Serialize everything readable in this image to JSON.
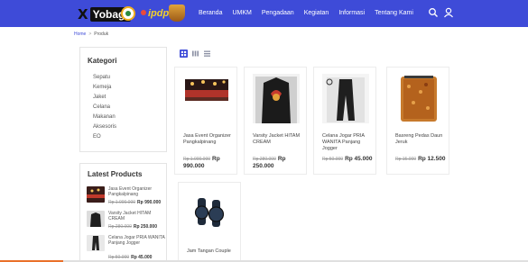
{
  "header": {
    "logo_text": "Yobagi",
    "logo_mark": "X",
    "partner_logo_text": "ipdp",
    "nav": [
      "Beranda",
      "UMKM",
      "Pengadaan",
      "Kegiatan",
      "Informasi",
      "Tentang Kami"
    ],
    "icons": [
      "search-icon",
      "user-icon"
    ],
    "accent": "#3e4bd8"
  },
  "breadcrumb": {
    "home": "Home",
    "separator": ">",
    "current": "Produk"
  },
  "sidebar": {
    "categories_title": "Kategori",
    "categories": [
      "Sepatu",
      "Kemeja",
      "Jaket",
      "Celana",
      "Makanan",
      "Aksesoris",
      "EO"
    ],
    "latest_title": "Latest Products",
    "latest": [
      {
        "name": "Jasa Event Organizer Pangkalpinang",
        "old_price": "Rp 1.000.000",
        "price": "Rp 990.000"
      },
      {
        "name": "Varsity Jacket HITAM CREAM",
        "old_price": "Rp 280.000",
        "price": "Rp 250.000"
      },
      {
        "name": "Celana Jogar PRIA WANITA Panjang Jogger",
        "old_price": "Rp 50.000",
        "price": "Rp 45.000"
      }
    ]
  },
  "view_toggles": [
    "grid-large-icon",
    "grid-small-icon",
    "list-icon"
  ],
  "products": [
    {
      "name": "Jasa Event Organizer Pangkalpinang",
      "old_price": "Rp 1.000.000",
      "price_prefix": "Rp",
      "price": "990.000"
    },
    {
      "name": "Varsity Jacket HITAM CREAM",
      "old_price": "Rp 280.000",
      "price_prefix": "Rp",
      "price": "250.000"
    },
    {
      "name": "Celana Jogar PRIA WANITA Panjang Jogger",
      "old_price": "Rp 50.000",
      "price_prefix": "",
      "price": "Rp 45.000"
    },
    {
      "name": "Basreng Pedas Daun Jeruk",
      "old_price": "Rp 15.000",
      "price_prefix": "",
      "price": "Rp 12.500"
    },
    {
      "name": "Jam Tangan Couple",
      "old_price": "",
      "price_prefix": "",
      "price": ""
    }
  ]
}
